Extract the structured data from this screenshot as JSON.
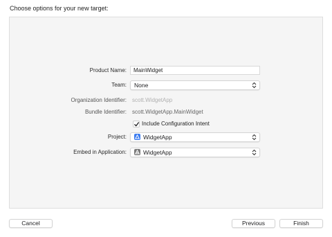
{
  "heading": "Choose options for your new target:",
  "form": {
    "product_name": {
      "label": "Product Name:",
      "value": "MainWidget"
    },
    "team": {
      "label": "Team:",
      "value": "None"
    },
    "org_identifier": {
      "label": "Organization Identifier:",
      "placeholder": "scott.WidgetApp"
    },
    "bundle_identifier": {
      "label": "Bundle Identifier:",
      "value": "scott.WidgetApp.MainWidget"
    },
    "include_config": {
      "label": "Include Configuration Intent",
      "checked": true
    },
    "project": {
      "label": "Project:",
      "value": "WidgetApp",
      "icon": "xcode-project-icon"
    },
    "embed": {
      "label": "Embed in Application:",
      "value": "WidgetApp",
      "icon": "app-target-icon"
    }
  },
  "buttons": {
    "cancel": "Cancel",
    "previous": "Previous",
    "finish": "Finish"
  },
  "colors": {
    "project_icon": "#3c7cf0",
    "app_icon": "#7a7a7a"
  }
}
